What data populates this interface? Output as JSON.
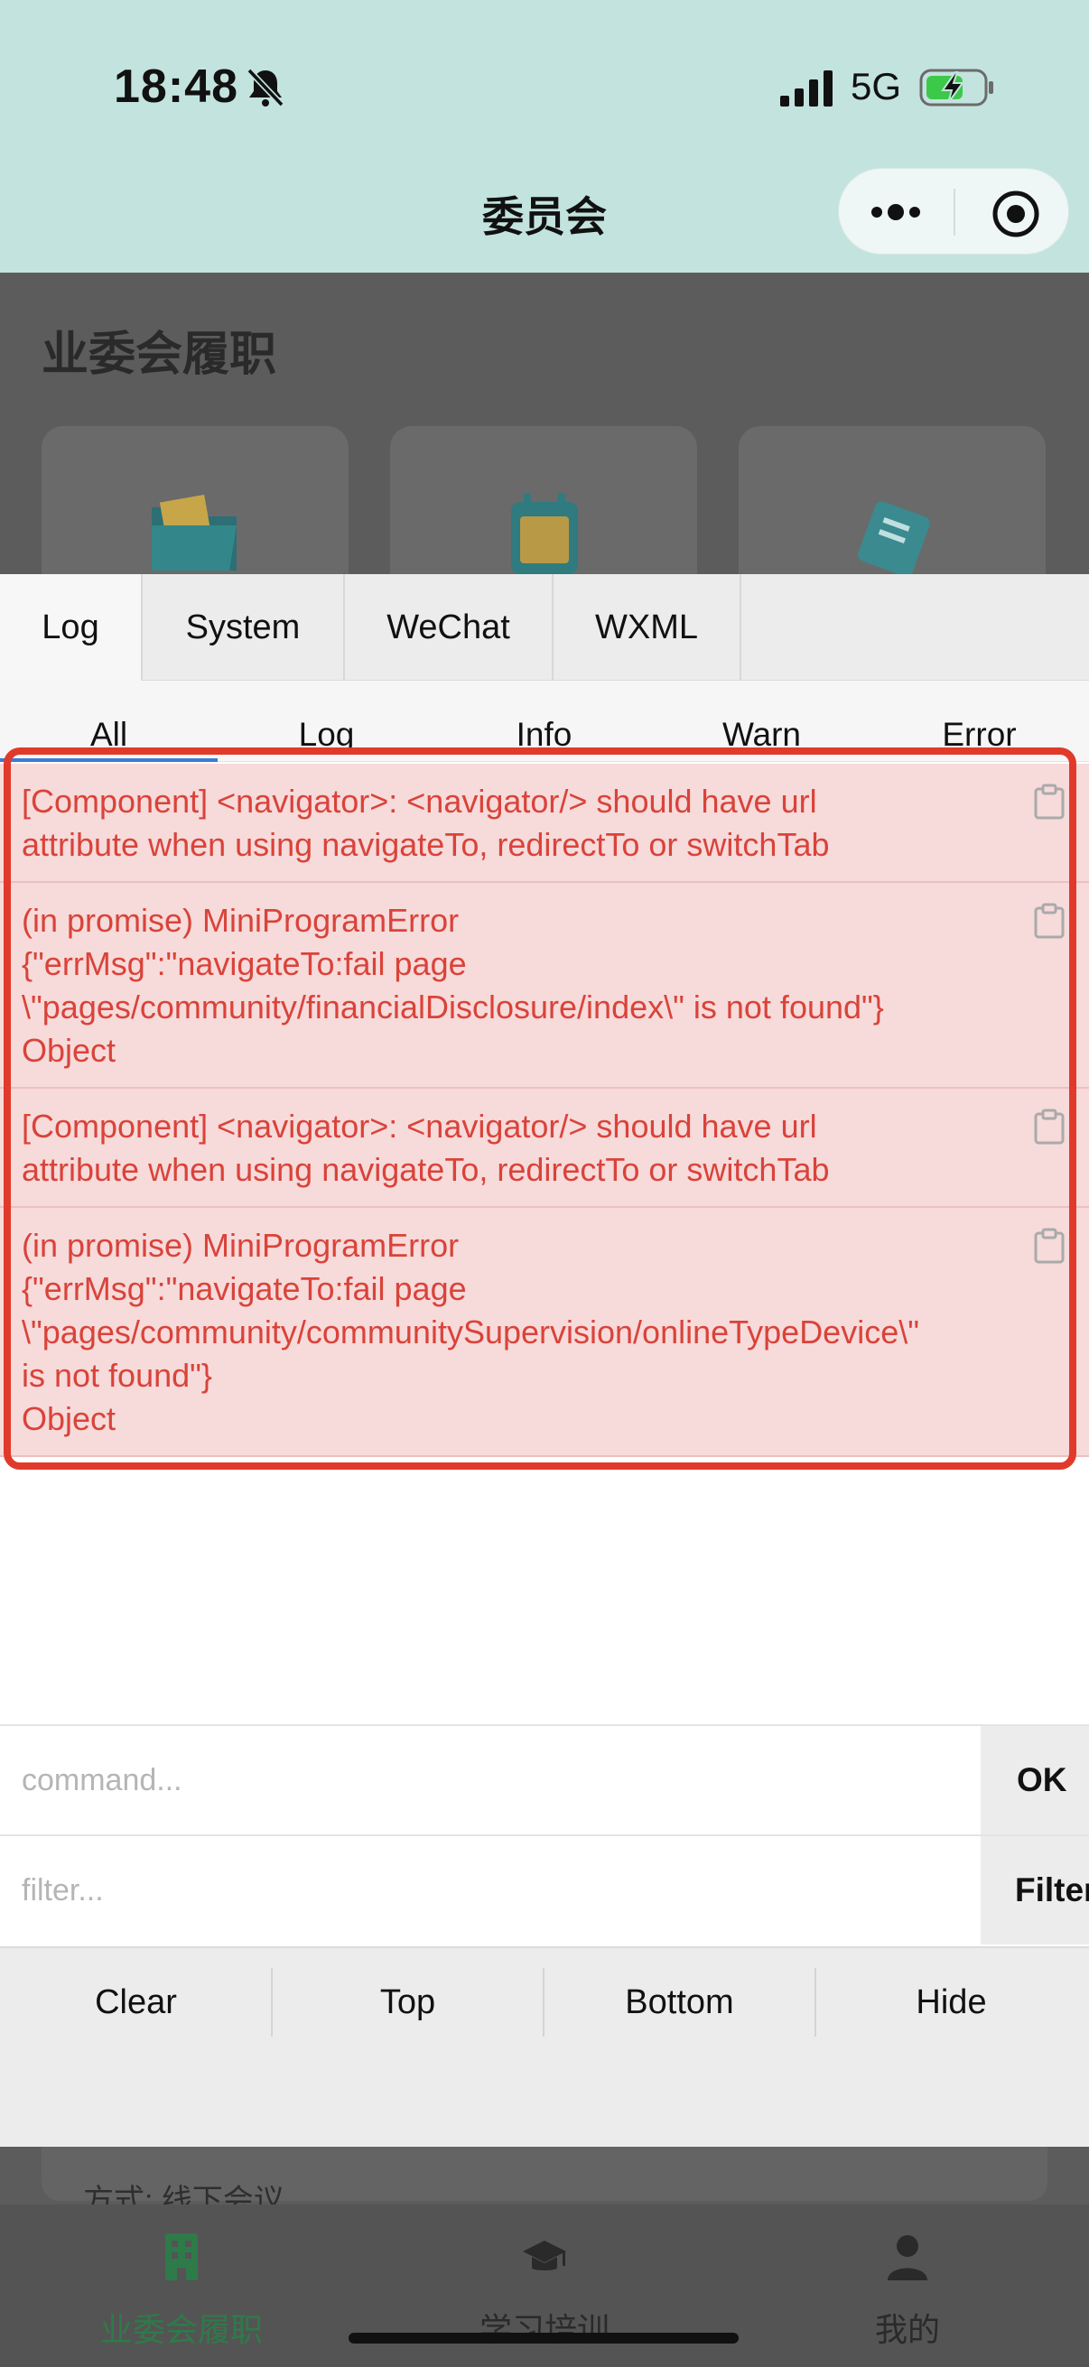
{
  "status_bar": {
    "time": "18:48",
    "network": "5G"
  },
  "nav": {
    "title": "委员会"
  },
  "background_page": {
    "section_title": "业委会履职",
    "meeting_text": "方式: 线下会议"
  },
  "console": {
    "tabs": [
      "Log",
      "System",
      "WeChat",
      "WXML"
    ],
    "subtabs": [
      "All",
      "Log",
      "Info",
      "Warn",
      "Error"
    ],
    "active_subtab": "All",
    "logs": [
      {
        "lines": [
          "[Component] <navigator>: <navigator/> should have url",
          "attribute when using navigateTo, redirectTo or switchTab"
        ]
      },
      {
        "lines": [
          "(in promise) MiniProgramError",
          "{\"errMsg\":\"navigateTo:fail page",
          "\\\"pages/community/financialDisclosure/index\\\" is not found\"}",
          "Object"
        ]
      },
      {
        "lines": [
          "[Component] <navigator>: <navigator/> should have url",
          "attribute when using navigateTo, redirectTo or switchTab"
        ]
      },
      {
        "lines": [
          "(in promise) MiniProgramError",
          "{\"errMsg\":\"navigateTo:fail page",
          "\\\"pages/community/communitySupervision/onlineTypeDevice\\\"",
          "is not found\"}",
          "Object"
        ]
      }
    ],
    "command_placeholder": "command...",
    "ok_label": "OK",
    "filter_placeholder": "filter...",
    "filter_label": "Filter",
    "actions": [
      "Clear",
      "Top",
      "Bottom",
      "Hide"
    ]
  },
  "bottom_nav": {
    "items": [
      "业委会履职",
      "学习培训",
      "我的"
    ]
  },
  "colors": {
    "header_bg": "#c3e3de",
    "error_text": "#d9433a",
    "error_bg": "#f7dada",
    "highlight_border": "#e03a2b",
    "active_tab_green": "#2f7a4a",
    "accent_blue": "#3a7bd5"
  }
}
